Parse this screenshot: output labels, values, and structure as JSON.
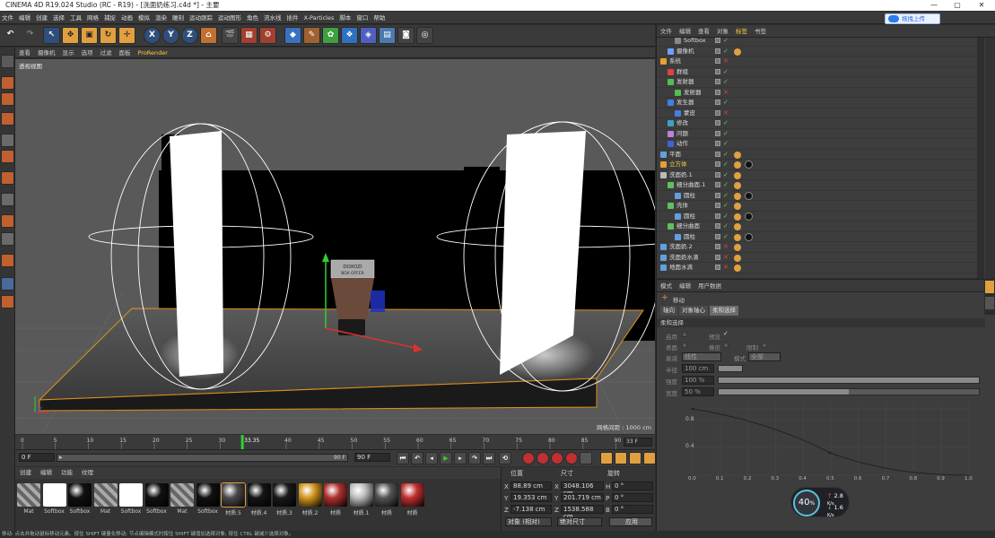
{
  "window": {
    "title": "CINEMA 4D R19.024 Studio (RC - R19) - [洗面奶练习.c4d *] - 主要",
    "min": "—",
    "max": "▢",
    "close": "✕"
  },
  "menu": [
    "文件",
    "编辑",
    "创建",
    "选择",
    "工具",
    "网格",
    "捕捉",
    "动画",
    "模拟",
    "渲染",
    "雕刻",
    "运动跟踪",
    "运动图形",
    "角色",
    "流水线",
    "插件",
    "X-Particles",
    "脚本",
    "窗口",
    "帮助"
  ],
  "cloud_button": "拖拽上传",
  "toolbar": {
    "x": "X",
    "y": "Y",
    "z": "Z"
  },
  "viewport_menu": [
    "查看",
    "摄像机",
    "显示",
    "选项",
    "过滤",
    "面板",
    "ProRender"
  ],
  "viewport": {
    "label": "透视视图",
    "grid": "网格间距 : 1000 cm",
    "tube_text1": "DOXOZI",
    "tube_text2": "BOX OFFER"
  },
  "timeline": {
    "ticks": [
      "0",
      "5",
      "10",
      "15",
      "20",
      "25",
      "30",
      "33.35",
      "40",
      "45",
      "50",
      "55",
      "60",
      "65",
      "70",
      "75",
      "80",
      "85",
      "90"
    ],
    "end": "33 F"
  },
  "timebar": {
    "start": "0 F",
    "arrow": "▸",
    "range_end": "90 F",
    "end": "90 F"
  },
  "mat_tabs": [
    "创建",
    "编辑",
    "功能",
    "纹理"
  ],
  "materials": [
    {
      "name": "Mat",
      "color": "#8a8a8a"
    },
    {
      "name": "Softbox",
      "color": "#ffffff"
    },
    {
      "name": "Softbox",
      "color": "#111111"
    },
    {
      "name": "Mat",
      "color": "#8a8a8a"
    },
    {
      "name": "Softbox",
      "color": "#ffffff"
    },
    {
      "name": "Softbox",
      "color": "#111111"
    },
    {
      "name": "Mat",
      "color": "#8a8a8a"
    },
    {
      "name": "Softbox",
      "color": "#111111"
    },
    {
      "name": "材质.5",
      "color": "#4a4a4a"
    },
    {
      "name": "材质.4",
      "color": "#151515"
    },
    {
      "name": "材质.3",
      "color": "#1a1a1a"
    },
    {
      "name": "材质.2",
      "color": "#d4961e"
    },
    {
      "name": "材质",
      "color": "#b03030"
    },
    {
      "name": "材质.1",
      "color": "#bdbdbd"
    },
    {
      "name": "材质",
      "color": "#555555"
    },
    {
      "name": "材质",
      "color": "#c03030"
    }
  ],
  "coord": {
    "headers": [
      "位置",
      "尺寸",
      "旋转"
    ],
    "rows": [
      {
        "a": "X",
        "pos": "88.89 cm",
        "b": "X",
        "size": "3048.106 cm",
        "c": "H",
        "rot": "0 °"
      },
      {
        "a": "Y",
        "pos": "19.353 cm",
        "b": "Y",
        "size": "201.719 cm",
        "c": "P",
        "rot": "0 °"
      },
      {
        "a": "Z",
        "pos": "-7.138 cm",
        "b": "Z",
        "size": "1538.588 cm",
        "c": "B",
        "rot": "0 °"
      }
    ],
    "mode1": "对象 (相对)",
    "mode2": "绝对尺寸",
    "apply": "应用"
  },
  "obj_tabs": [
    "文件",
    "编辑",
    "查看",
    "对象",
    "标签",
    "书签"
  ],
  "objects": [
    {
      "name": "Softbox",
      "indent": 2,
      "color": "#888",
      "state": "✓"
    },
    {
      "name": "摄像机",
      "indent": 1,
      "color": "#6aa0ff",
      "state": "✓"
    },
    {
      "name": "系统",
      "indent": 0,
      "color": "#e8a030",
      "state": "✕"
    },
    {
      "name": "群组",
      "indent": 1,
      "color": "#e04040",
      "state": "✓"
    },
    {
      "name": "发射器",
      "indent": 1,
      "color": "#50c050",
      "state": "✓"
    },
    {
      "name": "发射器",
      "indent": 2,
      "color": "#50c050",
      "state": "✕"
    },
    {
      "name": "发生器",
      "indent": 1,
      "color": "#4080e0",
      "state": "✓"
    },
    {
      "name": "蒙皮",
      "indent": 2,
      "color": "#4080e0",
      "state": "✕"
    },
    {
      "name": "修改",
      "indent": 1,
      "color": "#40a0c0",
      "state": "✓"
    },
    {
      "name": "问题",
      "indent": 1,
      "color": "#c080e0",
      "state": "✓"
    },
    {
      "name": "动作",
      "indent": 1,
      "color": "#4060e0",
      "state": "✓"
    },
    {
      "name": "平面",
      "indent": 0,
      "color": "#60a0e0",
      "state": "✓"
    },
    {
      "name": "立方体",
      "indent": 0,
      "color": "#e8a030",
      "state": "✓"
    },
    {
      "name": "洗面奶.1",
      "indent": 0,
      "color": "#bbb",
      "state": "✓"
    },
    {
      "name": "细分曲面.1",
      "indent": 1,
      "color": "#60c060",
      "state": "✓"
    },
    {
      "name": "圆柱",
      "indent": 2,
      "color": "#60a0e0",
      "state": "✓"
    },
    {
      "name": "壳体",
      "indent": 1,
      "color": "#60c060",
      "state": "✓"
    },
    {
      "name": "圆柱",
      "indent": 2,
      "color": "#60a0e0",
      "state": "✓"
    },
    {
      "name": "细分曲面",
      "indent": 1,
      "color": "#60c060",
      "state": "✓"
    },
    {
      "name": "圆柱",
      "indent": 2,
      "color": "#60a0e0",
      "state": "✓"
    },
    {
      "name": "洗面奶.2",
      "indent": 0,
      "color": "#60a0e0",
      "state": "✕"
    },
    {
      "name": "洗面奶水滴",
      "indent": 0,
      "color": "#60a0e0",
      "state": "✕"
    },
    {
      "name": "地面水滴",
      "indent": 0,
      "color": "#60a0e0",
      "state": "✕"
    }
  ],
  "attr_tabs": [
    "模式",
    "编辑",
    "用户数据"
  ],
  "attr": {
    "tool": "移动",
    "subtabs": [
      "轴向",
      "对象轴心",
      "柔和选择"
    ],
    "section": "柔和选择",
    "enable": "启用",
    "preview": "预览",
    "surface": "表面",
    "rubber": "橡皮",
    "restrict": "限制",
    "mode_label": "衰减",
    "mode_val": "线性",
    "mode2_label": "模式",
    "mode2_val": "全部",
    "radius": "半径",
    "radius_val": "100 cm",
    "strength": "强度",
    "strength_val": "100 %",
    "width": "宽度",
    "width_val": "50 %"
  },
  "graph": {
    "y_labels": [
      "1",
      "0.8",
      "0.4"
    ],
    "x_labels": [
      "0.0",
      "0.1",
      "0.2",
      "0.3",
      "0.4",
      "0.5",
      "0.6",
      "0.7",
      "0.8",
      "0.9",
      "1.0"
    ]
  },
  "speed": {
    "percent": "40",
    "unit": "%",
    "up": "2.8",
    "down": "1.6",
    "rate": "K/s"
  },
  "status": "移动: 点击并拖动鼠标移动元素。按住 SHIFT 键量化移动; 节点编辑模式时按住 SHIFT 键增加选择对象; 按住 CTRL 键减少选择对象。"
}
